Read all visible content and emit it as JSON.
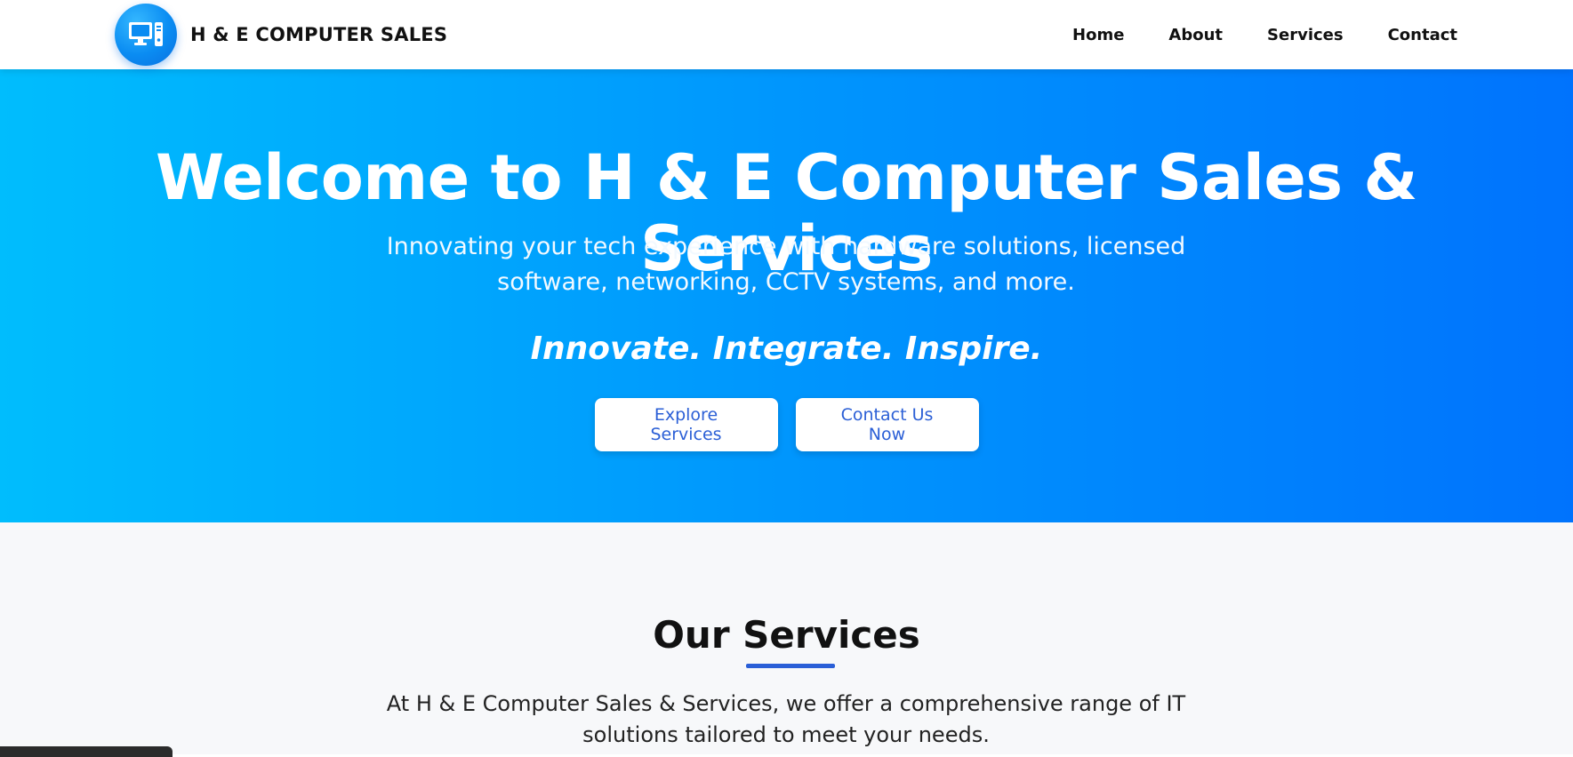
{
  "navbar": {
    "brand_name": "H & E COMPUTER SALES",
    "brand_icon": "desktop-computer-icon",
    "links": [
      {
        "label": "Home"
      },
      {
        "label": "About"
      },
      {
        "label": "Services"
      },
      {
        "label": "Contact"
      }
    ]
  },
  "hero": {
    "title": "Welcome to H & E Computer Sales & Services",
    "subtitle": "Innovating your tech experience with hardware solutions, licensed software, networking, CCTV systems, and more.",
    "tagline": "Innovate. Integrate. Inspire.",
    "buttons": {
      "explore_label": "Explore Services",
      "contact_label": "Contact Us Now"
    }
  },
  "services": {
    "title": "Our Services",
    "description": "At H & E Computer Sales & Services, we offer a comprehensive range of IT solutions tailored to meet your needs."
  },
  "colors": {
    "hero_gradient_start": "#00bdfd",
    "hero_gradient_end": "#0073fd",
    "accent_blue": "#2a5fd7",
    "section_bg": "#f7f8fa"
  }
}
